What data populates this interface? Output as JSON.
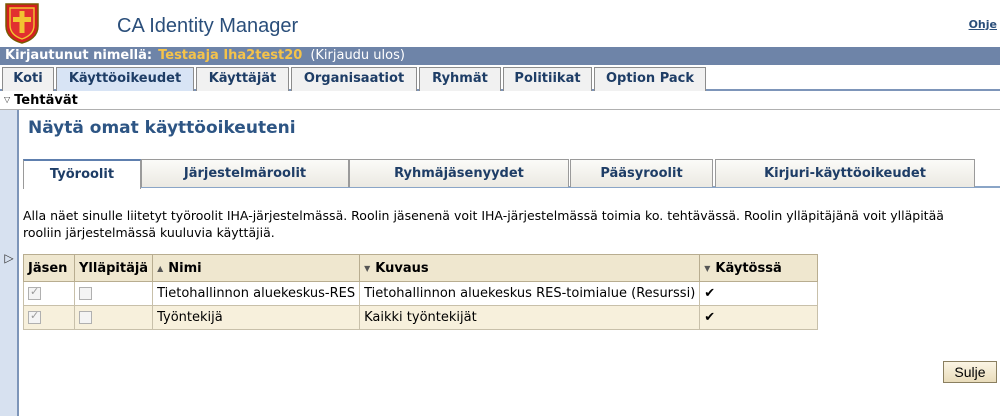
{
  "header": {
    "app_title": "CA Identity Manager",
    "help_label": "Ohje"
  },
  "login_bar": {
    "label": "Kirjautunut nimellä:",
    "user": "Testaaja Iha2test20",
    "logout": "(Kirjaudu ulos)"
  },
  "main_tabs": [
    {
      "label": "Koti"
    },
    {
      "label": "Käyttöoikeudet"
    },
    {
      "label": "Käyttäjät"
    },
    {
      "label": "Organisaatiot"
    },
    {
      "label": "Ryhmät"
    },
    {
      "label": "Politiikat"
    },
    {
      "label": "Option Pack"
    }
  ],
  "tasks_label": "Tehtävät",
  "page_title": "Näytä omat käyttöoikeuteni",
  "sub_tabs": [
    {
      "label": "Työroolit"
    },
    {
      "label": "Järjestelmäroolit"
    },
    {
      "label": "Ryhmäjäsenyydet"
    },
    {
      "label": "Pääsyroolit"
    },
    {
      "label": "Kirjuri-käyttöoikeudet"
    }
  ],
  "description": "Alla näet sinulle liitetyt työroolit IHA-järjestelmässä. Roolin jäsenenä voit IHA-järjestelmässä toimia ko. tehtävässä. Roolin ylläpitäjänä voit ylläpitää rooliin järjestelmässä kuuluvia käyttäjiä.",
  "table": {
    "columns": {
      "member": "Jäsen",
      "admin": "Ylläpitäjä",
      "name": "Nimi",
      "description": "Kuvaus",
      "enabled": "Käytössä"
    },
    "rows": [
      {
        "name": "Tietohallinnon aluekeskus-RES",
        "description": "Tietohallinnon aluekeskus RES-toimialue (Resurssi)",
        "enabled": "✔"
      },
      {
        "name": "Työntekijä",
        "description": "Kaikki työntekijät",
        "enabled": "✔"
      }
    ]
  },
  "close_label": "Sulje"
}
